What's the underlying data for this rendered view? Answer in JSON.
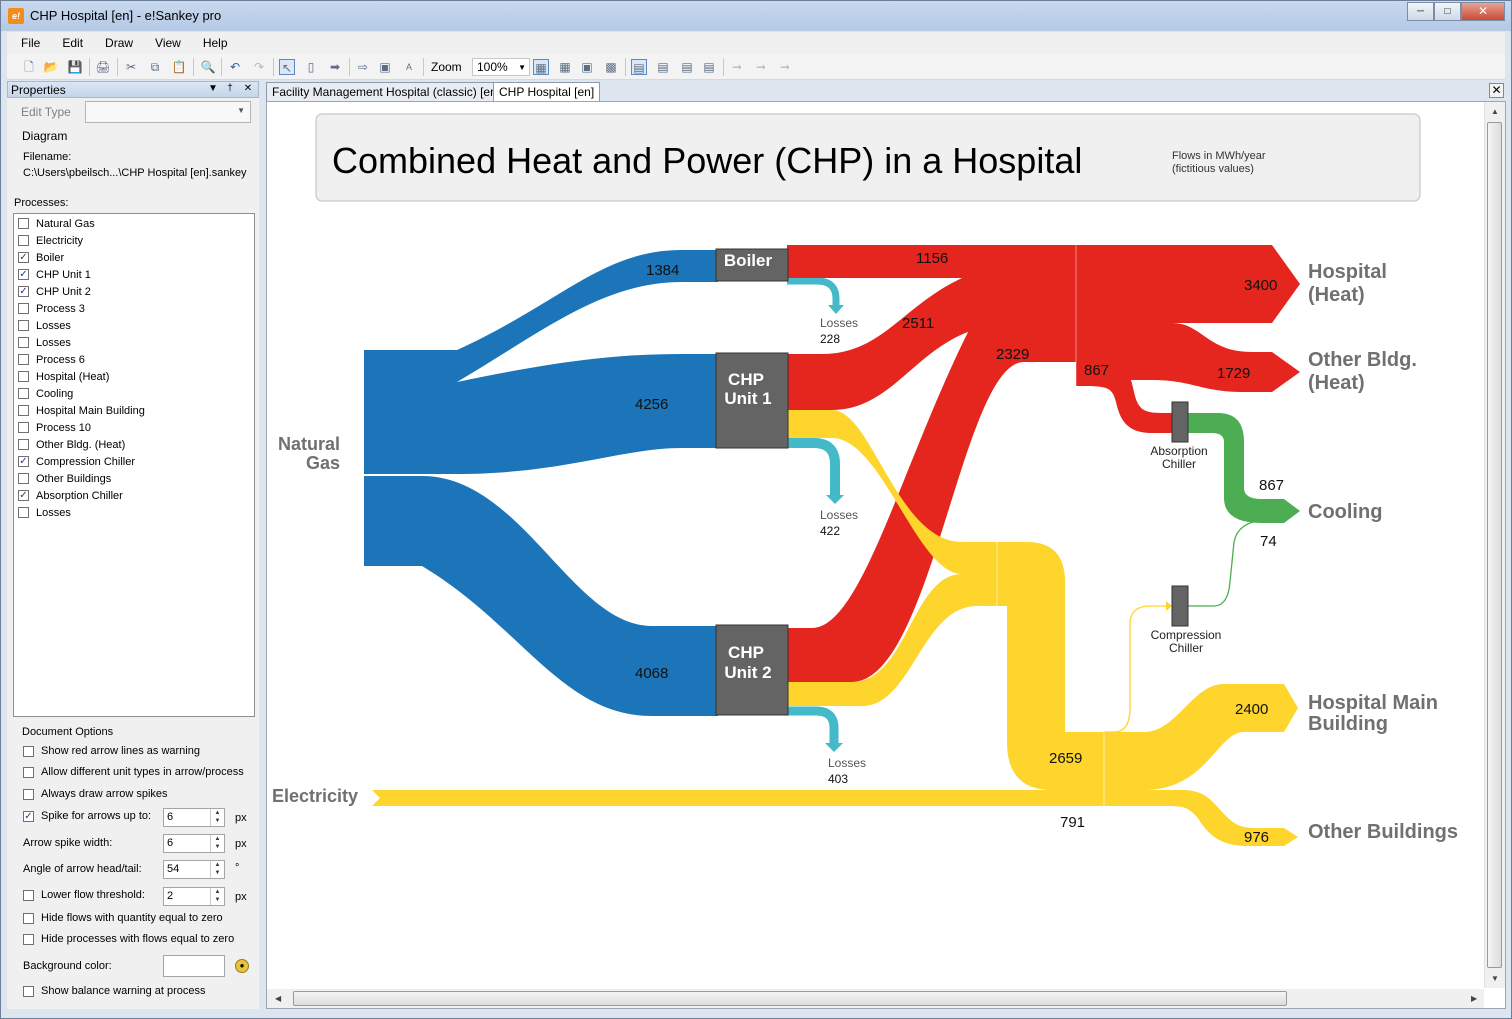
{
  "window": {
    "title": "CHP Hospital [en] - e!Sankey pro",
    "app_icon_text": "e!"
  },
  "menu": [
    "File",
    "Edit",
    "Draw",
    "View",
    "Help"
  ],
  "toolbar": {
    "zoom_label": "Zoom",
    "zoom_value": "100%"
  },
  "properties": {
    "title": "Properties",
    "edit_type_label": "Edit Type",
    "diagram_label": "Diagram",
    "filename_label": "Filename:",
    "filename_value": "C:\\Users\\pbeilsch...\\CHP Hospital [en].sankey",
    "processes_label": "Processes:",
    "processes": [
      {
        "name": "Natural Gas",
        "checked": false
      },
      {
        "name": "Electricity",
        "checked": false
      },
      {
        "name": "Boiler",
        "checked": true
      },
      {
        "name": "CHP Unit 1",
        "checked": true
      },
      {
        "name": "CHP Unit 2",
        "checked": true
      },
      {
        "name": "Process 3",
        "checked": false
      },
      {
        "name": "Losses",
        "checked": false
      },
      {
        "name": "Losses",
        "checked": false
      },
      {
        "name": "Process 6",
        "checked": false
      },
      {
        "name": "Hospital (Heat)",
        "checked": false
      },
      {
        "name": "Cooling",
        "checked": false
      },
      {
        "name": "Hospital Main Building",
        "checked": false
      },
      {
        "name": "Process 10",
        "checked": false
      },
      {
        "name": "Other Bldg. (Heat)",
        "checked": false
      },
      {
        "name": "Compression Chiller",
        "checked": true
      },
      {
        "name": "Other Buildings",
        "checked": false
      },
      {
        "name": "Absorption Chiller",
        "checked": true
      },
      {
        "name": "Losses",
        "checked": false
      }
    ],
    "document_options_label": "Document Options",
    "options": {
      "red_arrow_lines": {
        "label": "Show red arrow lines as warning",
        "checked": false
      },
      "different_units": {
        "label": "Allow different unit types in arrow/process",
        "checked": false
      },
      "always_spikes": {
        "label": "Always draw arrow spikes",
        "checked": false
      },
      "spike_for_arrows": {
        "label": "Spike for arrows up to:",
        "checked": true,
        "value": "6",
        "unit": "px"
      },
      "arrow_spike_width": {
        "label": "Arrow spike width:",
        "value": "6",
        "unit": "px"
      },
      "arrow_angle": {
        "label": "Angle of arrow head/tail:",
        "value": "54",
        "unit": "°"
      },
      "lower_threshold": {
        "label": "Lower flow threshold:",
        "checked": false,
        "value": "2",
        "unit": "px"
      },
      "hide_zero_flows": {
        "label": "Hide flows with quantity equal to zero",
        "checked": false
      },
      "hide_zero_processes": {
        "label": "Hide processes with flows equal to zero",
        "checked": false
      },
      "background_color_label": "Background color:",
      "balance_warning": {
        "label": "Show balance warning at process",
        "checked": false
      }
    }
  },
  "tabs": [
    {
      "label": "Facility Management Hospital (classic) [en]",
      "active": false
    },
    {
      "label": "CHP Hospital [en]",
      "active": true
    }
  ],
  "diagram": {
    "title": "Combined Heat and Power (CHP) in a Hospital",
    "note_line1": "Flows in MWh/year",
    "note_line2": "(fictitious values)",
    "colors": {
      "gas": "#1b75b8",
      "heat": "#e4261f",
      "power": "#fdd52d",
      "cooling": "#4cad52",
      "losses": "#43b9c9",
      "process": "#646464"
    },
    "sources": {
      "gas_1": "Natural",
      "gas_2": "Gas",
      "electricity": "Electricity"
    },
    "processes": {
      "boiler": "Boiler",
      "chp1_1": "CHP",
      "chp1_2": "Unit 1",
      "chp2_1": "CHP",
      "chp2_2": "Unit 2",
      "absorption_1": "Absorption",
      "absorption_2": "Chiller",
      "compression_1": "Compression",
      "compression_2": "Chiller"
    },
    "sinks": {
      "hospital_heat_1": "Hospital",
      "hospital_heat_2": "(Heat)",
      "other_heat_1": "Other Bldg.",
      "other_heat_2": "(Heat)",
      "cooling": "Cooling",
      "main_building_1": "Hospital Main",
      "main_building_2": "Building",
      "other_buildings": "Other Buildings"
    },
    "losses": {
      "label": "Losses",
      "boiler": "228",
      "chp1": "422",
      "chp2": "403"
    },
    "flows": {
      "gas_boiler": "1384",
      "gas_chp1": "4256",
      "gas_chp2": "4068",
      "boiler_heat": "1156",
      "chp1_heat": "2511",
      "chp2_heat": "2329",
      "hospital_heat": "3400",
      "other_heat": "1729",
      "absorption_in": "867",
      "cooling_absorption": "867",
      "cooling_compression": "74",
      "power_merge": "2659",
      "electricity": "791",
      "main_building": "2400",
      "other_buildings": "976"
    }
  }
}
